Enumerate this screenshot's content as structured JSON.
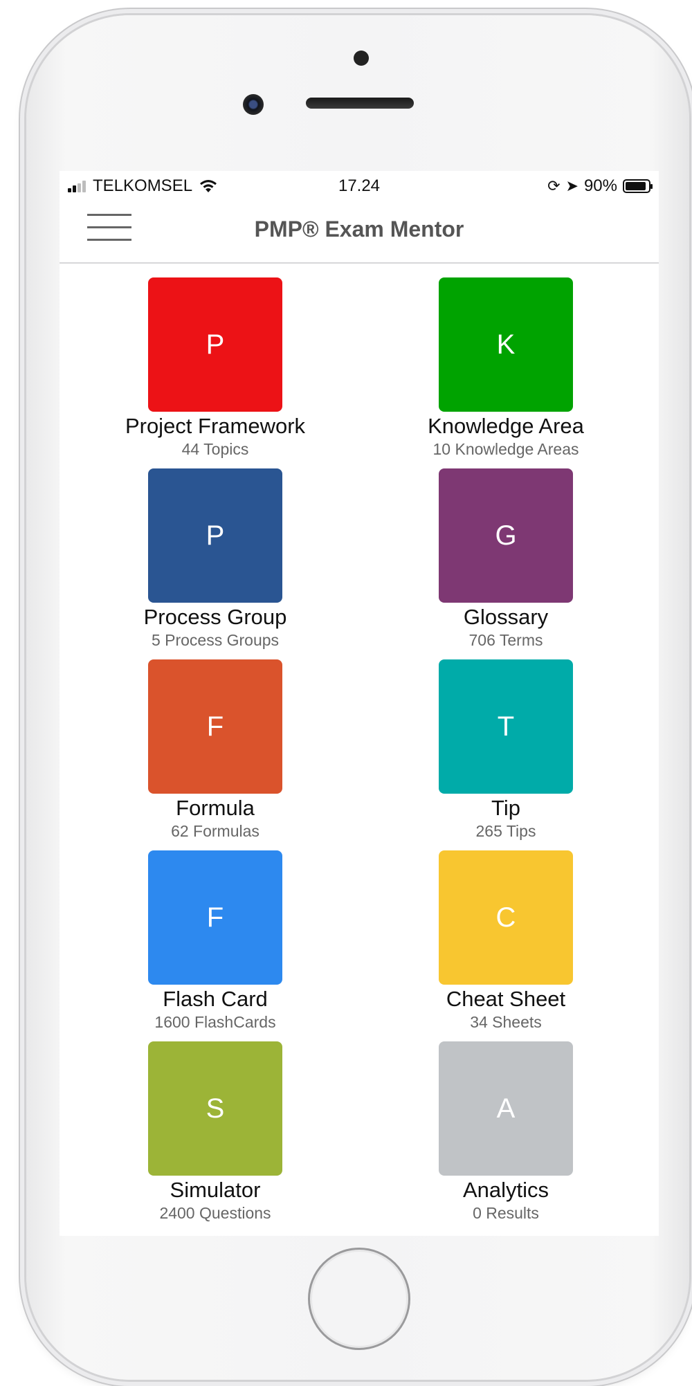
{
  "status_bar": {
    "carrier": "TELKOMSEL",
    "time": "17.24",
    "battery_percent": "90%",
    "battery_level": 0.9
  },
  "nav": {
    "title": "PMP® Exam Mentor"
  },
  "tiles": [
    {
      "letter": "P",
      "label": "Project Framework",
      "count": "44 Topics",
      "color": "#ec1216"
    },
    {
      "letter": "K",
      "label": "Knowledge Area",
      "count": "10 Knowledge Areas",
      "color": "#00a300"
    },
    {
      "letter": "P",
      "label": "Process Group",
      "count": "5 Process Groups",
      "color": "#2a5592"
    },
    {
      "letter": "G",
      "label": "Glossary",
      "count": "706 Terms",
      "color": "#7e3873"
    },
    {
      "letter": "F",
      "label": "Formula",
      "count": "62 Formulas",
      "color": "#da532c"
    },
    {
      "letter": "T",
      "label": "Tip",
      "count": "265 Tips",
      "color": "#00aba9"
    },
    {
      "letter": "F",
      "label": "Flash Card",
      "count": "1600 FlashCards",
      "color": "#2d89ef"
    },
    {
      "letter": "C",
      "label": "Cheat Sheet",
      "count": "34 Sheets",
      "color": "#f8c630"
    },
    {
      "letter": "S",
      "label": "Simulator",
      "count": "2400 Questions",
      "color": "#9cb437"
    },
    {
      "letter": "A",
      "label": "Analytics",
      "count": "0 Results",
      "color": "#c0c3c6"
    }
  ]
}
